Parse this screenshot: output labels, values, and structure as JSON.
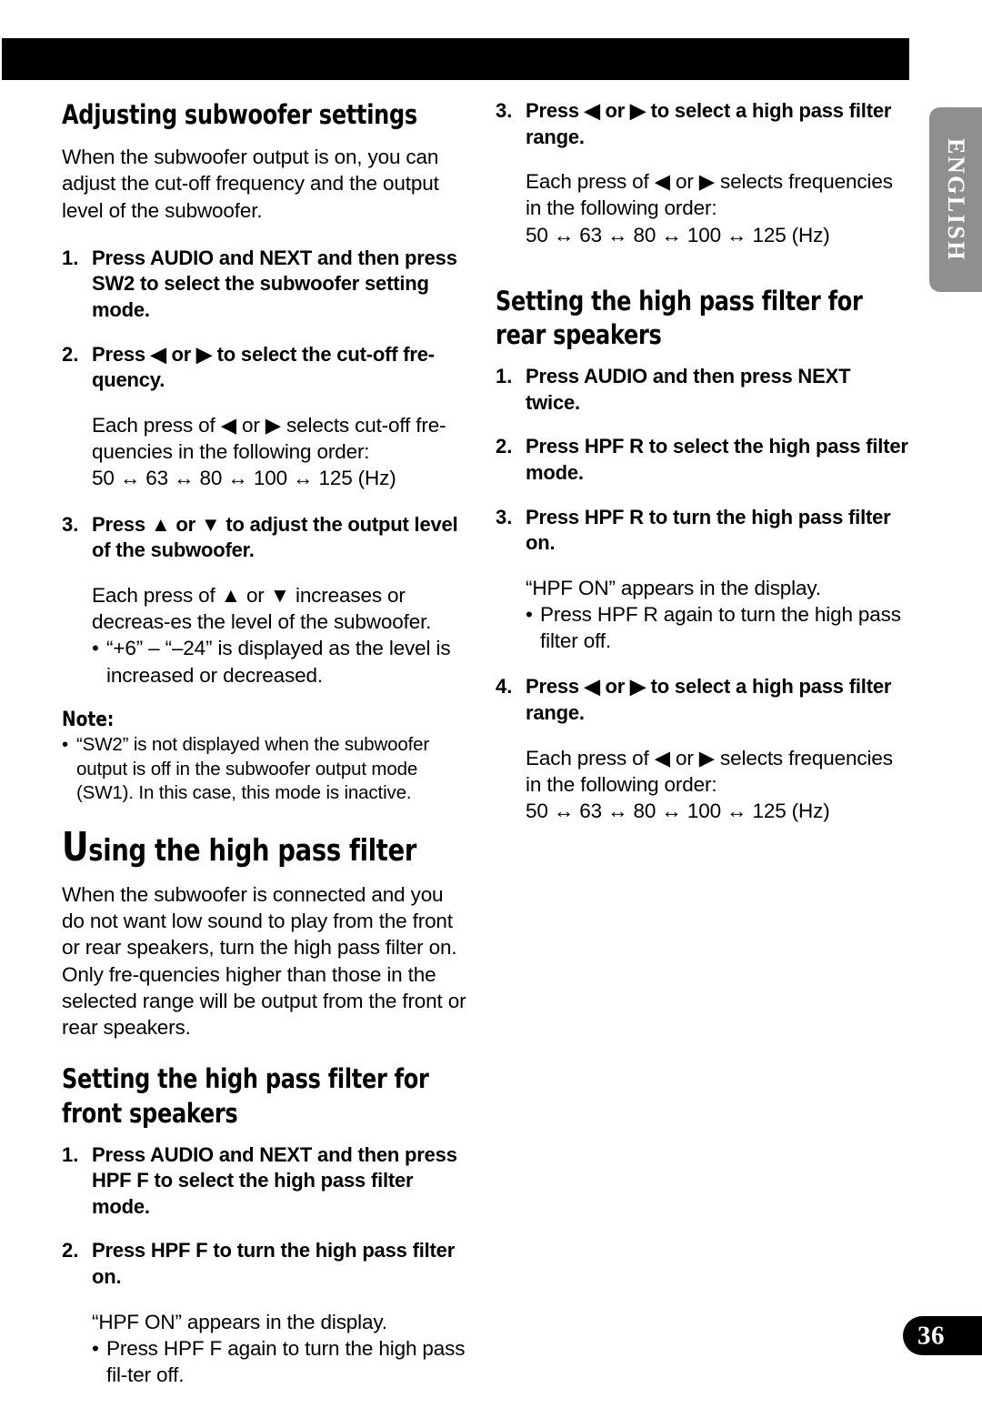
{
  "page": {
    "number": "36",
    "language_tab": "ENGLISH"
  },
  "colors": {
    "banner": "#000000",
    "language_tab_bg": "#8f8f8f",
    "language_tab_text": "#ffffff",
    "page_number_bg": "#000000",
    "page_number_text": "#ffffff",
    "body_text": "#000000"
  },
  "left_column": {
    "section1": {
      "heading": "Adjusting subwoofer settings",
      "intro": "When the subwoofer output is on, you can adjust the cut-off frequency and the output level of the subwoofer.",
      "steps": [
        {
          "num": "1.",
          "text": "Press AUDIO and NEXT and then press SW2 to select the subwoofer setting mode."
        },
        {
          "num": "2.",
          "text": "Press ◀ or ▶ to select the cut-off fre-quency.",
          "detail": "Each press of ◀ or ▶ selects cut-off fre-quencies in the following order:",
          "sequence": "50 ↔ 63 ↔ 80 ↔ 100 ↔ 125 (Hz)"
        },
        {
          "num": "3.",
          "text": "Press ▲ or ▼ to adjust the output level of the subwoofer.",
          "detail": "Each press of ▲ or ▼ increases or decreas-es the level of the subwoofer.",
          "bullet": "“+6” – “–24” is displayed as the level is increased or decreased."
        }
      ],
      "note_label": "Note:",
      "note_bullet": "“SW2” is not displayed when the subwoofer output is off in the subwoofer output mode (SW1). In this case, this mode is inactive."
    },
    "section2": {
      "heading_cap": "U",
      "heading_rest": "sing the high pass filter",
      "intro": "When the subwoofer is connected and you do not want low sound to play from the front or rear speakers, turn the high pass filter on. Only fre-quencies higher than those in the selected range will be output from the front or rear speakers.",
      "subheading": "Setting the high pass filter for front speakers",
      "steps": [
        {
          "num": "1.",
          "text": "Press AUDIO and NEXT and then press HPF F to select the high pass filter mode."
        },
        {
          "num": "2.",
          "text": "Press HPF F to turn the high pass filter on.",
          "detail": "“HPF ON” appears in the display.",
          "bullet": "Press HPF F again to turn the high pass fil-ter off."
        }
      ]
    }
  },
  "right_column": {
    "continued_step": {
      "num": "3.",
      "text": "Press ◀ or ▶ to select a high pass filter range.",
      "detail": "Each press of ◀ or ▶ selects frequencies in the following order:",
      "sequence": "50 ↔ 63 ↔ 80 ↔ 100 ↔ 125 (Hz)"
    },
    "section3": {
      "subheading": "Setting the high pass filter for rear speakers",
      "steps": [
        {
          "num": "1.",
          "text": "Press AUDIO and then press NEXT twice."
        },
        {
          "num": "2.",
          "text": "Press HPF R to select the high pass filter mode."
        },
        {
          "num": "3.",
          "text": "Press HPF R to turn the high pass filter on.",
          "detail": "“HPF ON” appears in the display.",
          "bullet": "Press HPF R again to turn the high pass filter off."
        },
        {
          "num": "4.",
          "text": "Press ◀ or ▶ to select a high pass filter range.",
          "detail": "Each press of ◀ or ▶ selects frequencies in the following order:",
          "sequence": "50 ↔ 63 ↔ 80 ↔ 100 ↔ 125 (Hz)"
        }
      ]
    }
  }
}
